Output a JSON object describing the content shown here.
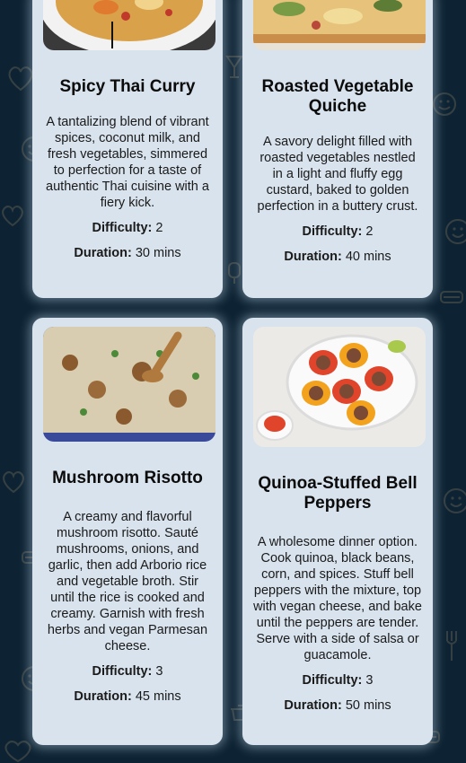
{
  "recipes": [
    {
      "title": "Spicy Thai Curry",
      "description": "A tantalizing blend of vibrant spices, coconut milk, and fresh vegetables, simmered to perfection for a taste of authentic Thai cuisine with a fiery kick.",
      "difficulty_label": "Difficulty:",
      "difficulty_value": "2",
      "duration_label": "Duration:",
      "duration_value": "30 mins"
    },
    {
      "title": "Roasted Vegetable Quiche",
      "description": "A savory delight filled with roasted vegetables nestled in a light and fluffy egg custard, baked to golden perfection in a buttery crust.",
      "difficulty_label": "Difficulty:",
      "difficulty_value": "2",
      "duration_label": "Duration:",
      "duration_value": "40 mins"
    },
    {
      "title": "Mushroom Risotto",
      "description": "A creamy and flavorful mushroom risotto. Sauté mushrooms, onions, and garlic, then add Arborio rice and vegetable broth. Stir until the rice is cooked and creamy. Garnish with fresh herbs and vegan Parmesan cheese.",
      "difficulty_label": "Difficulty:",
      "difficulty_value": "3",
      "duration_label": "Duration:",
      "duration_value": "45 mins"
    },
    {
      "title": "Quinoa-Stuffed Bell Peppers",
      "description": "A wholesome dinner option. Cook quinoa, black beans, corn, and spices. Stuff bell peppers with the mixture, top with vegan cheese, and bake until the peppers are tender. Serve with a side of salsa or guacamole.",
      "difficulty_label": "Difficulty:",
      "difficulty_value": "3",
      "duration_label": "Duration:",
      "duration_value": "50 mins"
    }
  ],
  "colors": {
    "background": "#0d2333",
    "card": "#d8e3ed",
    "card_glow": "#c8e1f5"
  }
}
